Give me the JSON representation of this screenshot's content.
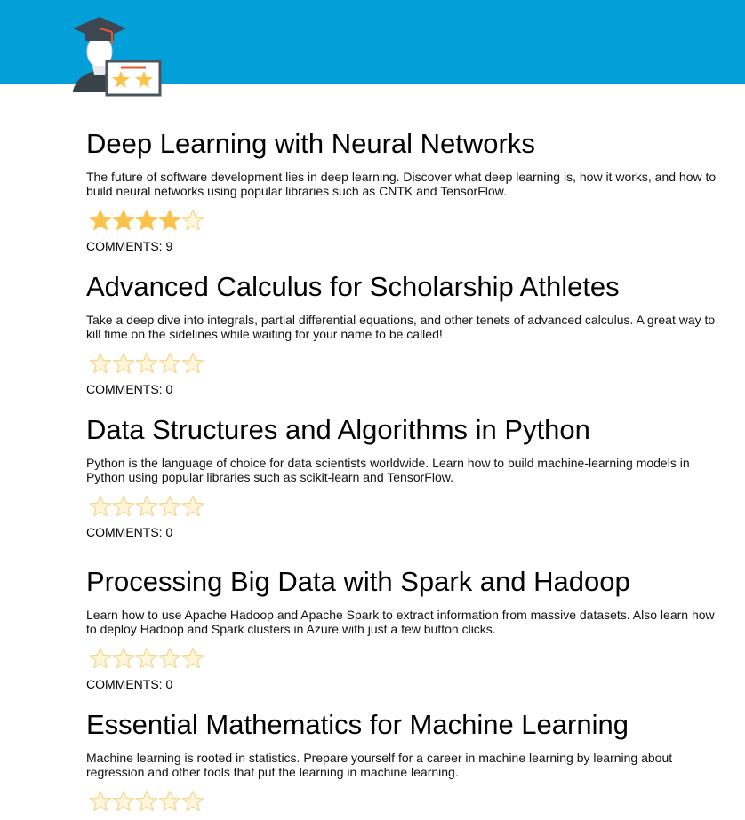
{
  "courses": [
    {
      "title": "Deep Learning with Neural Networks",
      "description": "The future of software development lies in deep learning. Discover what deep learning is, how it works, and how to build neural networks using popular libraries such as CNTK and TensorFlow.",
      "rating": 4,
      "comments": "COMMENTS: 9"
    },
    {
      "title": "Advanced Calculus for Scholarship Athletes",
      "description": "Take a deep dive into integrals, partial differential equations, and other tenets of advanced calculus. A great way to kill time on the sidelines while waiting for your name to be called!",
      "rating": 0,
      "comments": "COMMENTS: 0"
    },
    {
      "title": "Data Structures and Algorithms in Python",
      "description": "Python is the language of choice for data scientists worldwide. Learn how to build machine-learning models in Python using popular libraries such as scikit-learn and TensorFlow.",
      "rating": 0,
      "comments": "COMMENTS: 0"
    },
    {
      "title": "Processing Big Data with Spark and Hadoop",
      "description": "Learn how to use Apache Hadoop and Apache Spark to extract information from massive datasets. Also learn how to deploy Hadoop and Spark clusters in Azure with just a few button clicks.",
      "rating": 0,
      "comments": "COMMENTS: 0"
    },
    {
      "title": "Essential Mathematics for Machine Learning",
      "description": "Machine learning is rooted in statistics. Prepare yourself for a career in machine learning by learning about regression and other tools that put the learning in machine learning.",
      "rating": 0,
      "comments": ""
    }
  ],
  "colors": {
    "header": "#029fd8",
    "star_filled": "#fbc24c",
    "star_empty_fill": "#fff6dc",
    "star_outline": "#f3d58c"
  },
  "icons": {
    "logo": "graduate-certificate-icon",
    "star": "star-icon"
  }
}
